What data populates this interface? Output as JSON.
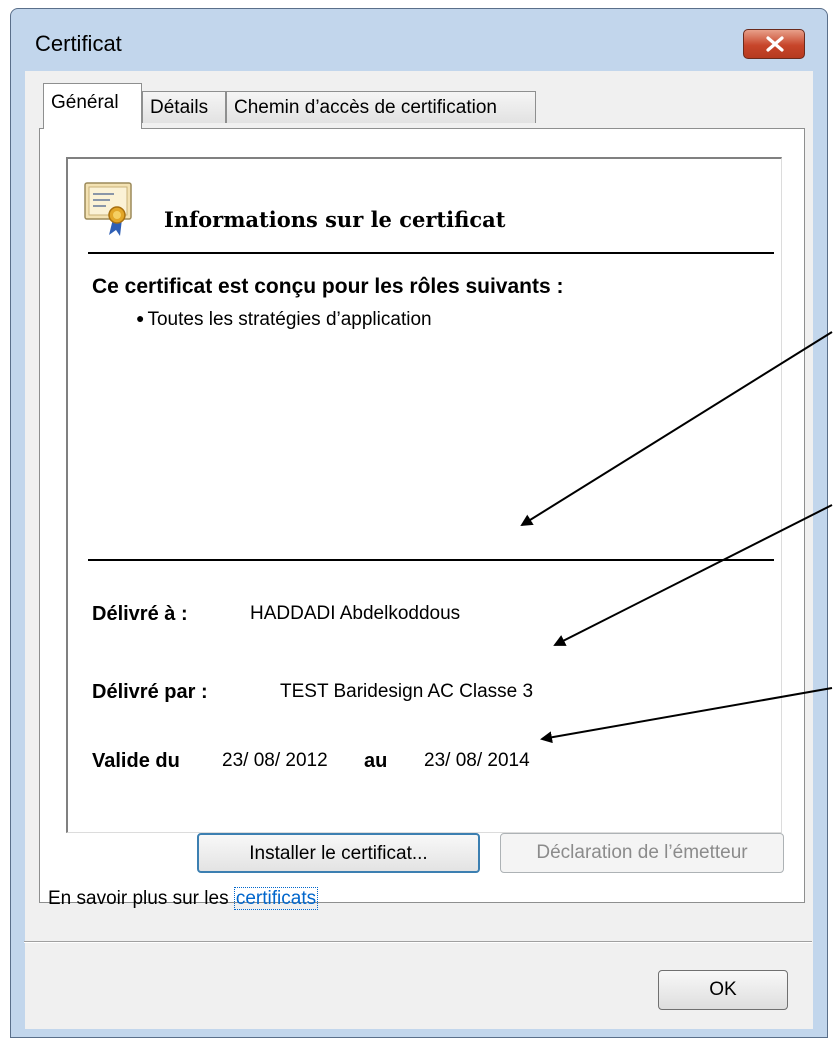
{
  "window": {
    "title": "Certificat"
  },
  "tabs": [
    {
      "label": "Général"
    },
    {
      "label": "Détails"
    },
    {
      "label": "Chemin d’accès de certification"
    }
  ],
  "certificate": {
    "header": "Informations sur le certificat",
    "roles_title": "Ce certificat est conçu pour les rôles suivants :",
    "roles": [
      "Toutes les stratégies d’application"
    ],
    "issued_to_label": "Délivré à :",
    "issued_to": "HADDADI Abdelkoddous",
    "issued_by_label": "Délivré par :",
    "issued_by": "TEST Baridesign AC Classe 3",
    "valid_from_label": "Valide du",
    "valid_from": "23/ 08/ 2012",
    "valid_to_label": "au",
    "valid_to": "23/ 08/ 2014"
  },
  "buttons": {
    "install": "Installer le certificat...",
    "issuer_statement": "Déclaration de l’émetteur",
    "ok": "OK"
  },
  "learn_more": {
    "prefix": "En savoir plus sur les ",
    "link": "certificats"
  },
  "colors": {
    "link": "#0066cc",
    "close_button": "#c7452a",
    "frame": "#c2d6ec"
  }
}
